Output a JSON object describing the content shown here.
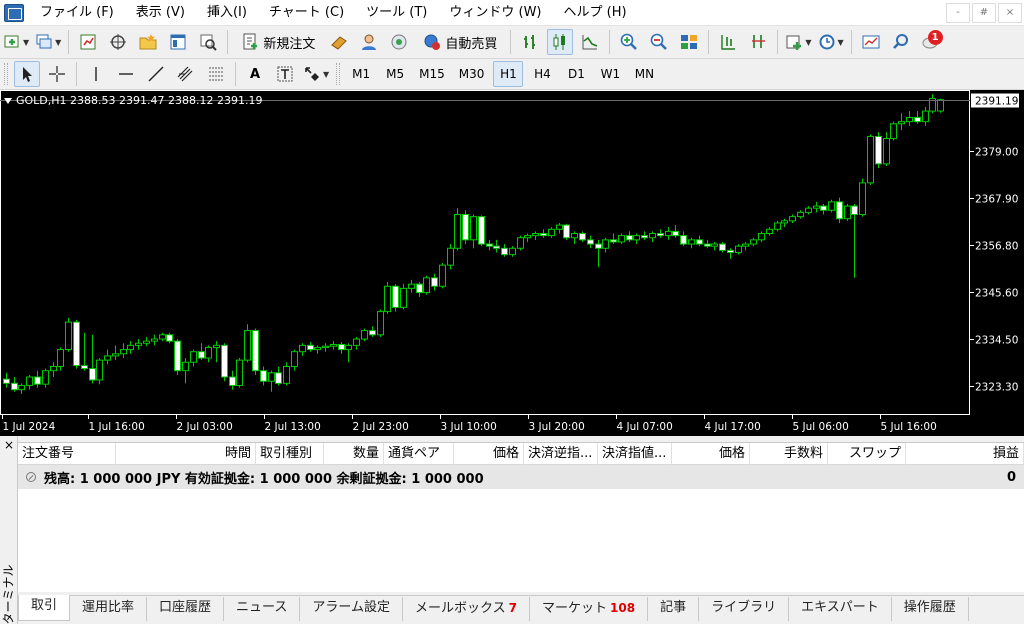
{
  "menu": {
    "items": [
      "ファイル (F)",
      "表示 (V)",
      "挿入(I)",
      "チャート (C)",
      "ツール (T)",
      "ウィンドウ (W)",
      "ヘルプ (H)"
    ],
    "win_controls": [
      "-",
      "#",
      "×"
    ]
  },
  "toolbar1": {
    "new_order_label": "新規注文",
    "auto_trading_label": "自動売買",
    "notification_count": "1"
  },
  "toolbar2": {
    "timeframes": [
      "M1",
      "M5",
      "M15",
      "M30",
      "H1",
      "H4",
      "D1",
      "W1",
      "MN"
    ],
    "active_timeframe": "H1",
    "text_tool": "A"
  },
  "chart": {
    "symbol_info": "GOLD,H1  2388.53 2391.47 2388.12 2391.19",
    "current_price": "2391.19",
    "colors": {
      "background": "#000000",
      "up_body": "#000000",
      "down_body": "#ffffff",
      "wick": "#00c800",
      "text": "#ffffff"
    }
  },
  "chart_data": {
    "type": "candlestick",
    "title": "GOLD,H1",
    "y_ticks": [
      2323.3,
      2334.5,
      2345.6,
      2356.8,
      2367.9,
      2379.0
    ],
    "ylim": [
      2316.5,
      2393.5
    ],
    "x_ticks": [
      "1 Jul 2024",
      "1 Jul 16:00",
      "2 Jul 03:00",
      "2 Jul 13:00",
      "2 Jul 23:00",
      "3 Jul 10:00",
      "3 Jul 20:00",
      "4 Jul 07:00",
      "4 Jul 17:00",
      "5 Jul 06:00",
      "5 Jul 16:00"
    ],
    "last": {
      "open": 2388.53,
      "high": 2391.47,
      "low": 2388.12,
      "close": 2391.19
    },
    "candles": [
      [
        2325.0,
        2326.5,
        2323.0,
        2324.0
      ],
      [
        2324.0,
        2325.5,
        2322.0,
        2322.5
      ],
      [
        2322.5,
        2324.0,
        2321.5,
        2323.5
      ],
      [
        2323.5,
        2326.0,
        2322.5,
        2325.5
      ],
      [
        2325.5,
        2327.0,
        2323.0,
        2323.8
      ],
      [
        2323.8,
        2327.5,
        2323.0,
        2327.0
      ],
      [
        2327.0,
        2329.0,
        2325.5,
        2328.0
      ],
      [
        2328.0,
        2332.5,
        2327.0,
        2332.0
      ],
      [
        2332.0,
        2339.5,
        2331.5,
        2338.5
      ],
      [
        2338.5,
        2339.0,
        2327.5,
        2328.2
      ],
      [
        2328.2,
        2336.0,
        2327.0,
        2327.5
      ],
      [
        2327.5,
        2335.5,
        2324.0,
        2324.8
      ],
      [
        2324.8,
        2330.0,
        2323.8,
        2329.5
      ],
      [
        2329.5,
        2332.0,
        2328.5,
        2330.5
      ],
      [
        2330.5,
        2333.0,
        2329.5,
        2331.0
      ],
      [
        2331.0,
        2333.5,
        2330.0,
        2332.0
      ],
      [
        2332.0,
        2334.0,
        2331.0,
        2333.0
      ],
      [
        2333.0,
        2334.5,
        2332.0,
        2333.5
      ],
      [
        2333.5,
        2335.0,
        2332.8,
        2334.0
      ],
      [
        2334.0,
        2335.5,
        2333.0,
        2334.5
      ],
      [
        2334.5,
        2336.0,
        2334.0,
        2335.5
      ],
      [
        2335.5,
        2336.0,
        2333.5,
        2334.0
      ],
      [
        2334.0,
        2334.5,
        2326.0,
        2327.0
      ],
      [
        2327.0,
        2330.0,
        2324.0,
        2329.0
      ],
      [
        2329.0,
        2332.0,
        2328.0,
        2331.5
      ],
      [
        2331.5,
        2333.5,
        2329.5,
        2330.0
      ],
      [
        2330.0,
        2333.0,
        2329.0,
        2332.5
      ],
      [
        2332.5,
        2334.0,
        2329.0,
        2333.0
      ],
      [
        2333.0,
        2333.5,
        2324.5,
        2325.5
      ],
      [
        2325.5,
        2327.0,
        2322.5,
        2323.5
      ],
      [
        2323.5,
        2330.0,
        2323.0,
        2329.5
      ],
      [
        2329.5,
        2338.0,
        2329.0,
        2336.5
      ],
      [
        2336.5,
        2337.0,
        2326.0,
        2327.0
      ],
      [
        2327.0,
        2328.0,
        2323.5,
        2324.5
      ],
      [
        2324.5,
        2327.0,
        2322.0,
        2326.5
      ],
      [
        2326.5,
        2328.0,
        2323.5,
        2324.0
      ],
      [
        2324.0,
        2329.0,
        2323.5,
        2328.0
      ],
      [
        2328.0,
        2332.0,
        2327.0,
        2331.5
      ],
      [
        2331.5,
        2333.5,
        2330.5,
        2333.0
      ],
      [
        2333.0,
        2333.8,
        2331.5,
        2332.0
      ],
      [
        2332.0,
        2333.0,
        2331.0,
        2332.5
      ],
      [
        2332.5,
        2333.5,
        2331.5,
        2332.8
      ],
      [
        2332.8,
        2334.0,
        2332.0,
        2333.2
      ],
      [
        2333.2,
        2333.8,
        2331.0,
        2332.0
      ],
      [
        2332.0,
        2333.5,
        2329.0,
        2333.0
      ],
      [
        2333.0,
        2335.0,
        2332.0,
        2334.5
      ],
      [
        2334.5,
        2337.0,
        2334.0,
        2336.5
      ],
      [
        2336.5,
        2337.5,
        2335.0,
        2335.5
      ],
      [
        2335.5,
        2341.5,
        2335.0,
        2341.0
      ],
      [
        2341.0,
        2348.0,
        2340.5,
        2347.0
      ],
      [
        2347.0,
        2347.5,
        2341.0,
        2342.0
      ],
      [
        2342.0,
        2347.5,
        2341.5,
        2346.5
      ],
      [
        2346.5,
        2348.5,
        2345.5,
        2347.5
      ],
      [
        2347.5,
        2348.0,
        2344.5,
        2345.5
      ],
      [
        2345.5,
        2349.5,
        2345.0,
        2349.0
      ],
      [
        2349.0,
        2350.0,
        2346.0,
        2347.0
      ],
      [
        2347.0,
        2352.5,
        2346.5,
        2352.0
      ],
      [
        2352.0,
        2357.0,
        2351.0,
        2356.0
      ],
      [
        2356.0,
        2365.5,
        2355.5,
        2364.0
      ],
      [
        2364.0,
        2365.0,
        2357.0,
        2358.0
      ],
      [
        2358.0,
        2364.0,
        2356.0,
        2363.5
      ],
      [
        2363.5,
        2363.8,
        2356.5,
        2357.0
      ],
      [
        2357.0,
        2358.0,
        2355.5,
        2356.5
      ],
      [
        2356.5,
        2358.0,
        2355.0,
        2356.0
      ],
      [
        2356.0,
        2357.0,
        2354.0,
        2354.5
      ],
      [
        2354.5,
        2356.5,
        2354.0,
        2356.0
      ],
      [
        2356.0,
        2359.0,
        2355.5,
        2358.5
      ],
      [
        2358.5,
        2359.5,
        2357.5,
        2359.0
      ],
      [
        2359.0,
        2360.0,
        2358.0,
        2359.5
      ],
      [
        2359.5,
        2360.5,
        2358.5,
        2359.0
      ],
      [
        2359.0,
        2361.0,
        2358.5,
        2360.5
      ],
      [
        2360.5,
        2362.0,
        2359.5,
        2361.5
      ],
      [
        2361.5,
        2361.8,
        2358.0,
        2358.5
      ],
      [
        2358.5,
        2360.0,
        2357.0,
        2359.5
      ],
      [
        2359.5,
        2360.0,
        2357.5,
        2358.0
      ],
      [
        2358.0,
        2359.0,
        2356.0,
        2357.0
      ],
      [
        2357.0,
        2358.0,
        2351.5,
        2356.0
      ],
      [
        2356.0,
        2358.5,
        2355.0,
        2358.0
      ],
      [
        2358.0,
        2359.5,
        2357.0,
        2357.5
      ],
      [
        2357.5,
        2359.5,
        2357.0,
        2359.0
      ],
      [
        2359.0,
        2360.0,
        2357.5,
        2358.0
      ],
      [
        2358.0,
        2359.5,
        2357.0,
        2359.0
      ],
      [
        2359.0,
        2360.0,
        2358.0,
        2358.5
      ],
      [
        2358.5,
        2360.0,
        2357.5,
        2359.5
      ],
      [
        2359.5,
        2360.5,
        2358.5,
        2359.0
      ],
      [
        2359.0,
        2361.0,
        2358.0,
        2360.0
      ],
      [
        2360.0,
        2361.5,
        2358.5,
        2359.0
      ],
      [
        2359.0,
        2360.0,
        2356.5,
        2357.0
      ],
      [
        2357.0,
        2358.5,
        2356.0,
        2358.0
      ],
      [
        2358.0,
        2359.0,
        2356.5,
        2357.0
      ],
      [
        2357.0,
        2358.0,
        2356.0,
        2356.5
      ],
      [
        2356.5,
        2357.5,
        2355.5,
        2357.0
      ],
      [
        2357.0,
        2357.5,
        2355.0,
        2355.5
      ],
      [
        2355.5,
        2356.0,
        2353.5,
        2355.0
      ],
      [
        2355.0,
        2357.0,
        2354.5,
        2356.5
      ],
      [
        2356.5,
        2357.5,
        2355.5,
        2357.0
      ],
      [
        2357.0,
        2358.5,
        2356.5,
        2358.0
      ],
      [
        2358.0,
        2360.0,
        2357.5,
        2359.5
      ],
      [
        2359.5,
        2361.0,
        2359.0,
        2360.5
      ],
      [
        2360.5,
        2362.5,
        2360.0,
        2362.0
      ],
      [
        2362.0,
        2363.0,
        2361.0,
        2362.5
      ],
      [
        2362.5,
        2364.0,
        2362.0,
        2363.5
      ],
      [
        2363.5,
        2365.0,
        2363.0,
        2364.5
      ],
      [
        2364.5,
        2366.0,
        2364.0,
        2365.5
      ],
      [
        2365.5,
        2367.0,
        2364.5,
        2366.0
      ],
      [
        2366.0,
        2366.5,
        2364.0,
        2365.0
      ],
      [
        2365.0,
        2367.5,
        2364.5,
        2367.0
      ],
      [
        2367.0,
        2368.0,
        2362.0,
        2363.0
      ],
      [
        2363.0,
        2366.5,
        2362.5,
        2366.0
      ],
      [
        2366.0,
        2366.5,
        2349.0,
        2364.0
      ],
      [
        2364.0,
        2372.5,
        2363.5,
        2371.5
      ],
      [
        2371.5,
        2383.0,
        2371.0,
        2382.5
      ],
      [
        2382.5,
        2383.5,
        2375.0,
        2376.0
      ],
      [
        2376.0,
        2383.5,
        2375.5,
        2382.0
      ],
      [
        2382.0,
        2386.0,
        2381.5,
        2385.5
      ],
      [
        2385.5,
        2388.0,
        2384.0,
        2386.0
      ],
      [
        2386.0,
        2388.5,
        2385.0,
        2387.0
      ],
      [
        2387.0,
        2388.5,
        2385.5,
        2386.0
      ],
      [
        2386.0,
        2389.5,
        2385.0,
        2388.5
      ],
      [
        2388.5,
        2392.5,
        2388.0,
        2391.5
      ],
      [
        2388.53,
        2391.47,
        2388.12,
        2391.19
      ]
    ]
  },
  "terminal": {
    "side_label": "ターミナル",
    "close": "×",
    "columns": [
      {
        "label": "注文番号",
        "align": "left"
      },
      {
        "label": "時間",
        "align": "right"
      },
      {
        "label": "取引種別",
        "align": "left"
      },
      {
        "label": "数量",
        "align": "right"
      },
      {
        "label": "通貨ペア",
        "align": "left"
      },
      {
        "label": "価格",
        "align": "right"
      },
      {
        "label": "決済逆指...",
        "align": "left"
      },
      {
        "label": "決済指値...",
        "align": "left"
      },
      {
        "label": "価格",
        "align": "right"
      },
      {
        "label": "手数料",
        "align": "right"
      },
      {
        "label": "スワップ",
        "align": "right"
      },
      {
        "label": "損益",
        "align": "right"
      }
    ],
    "balance_text": "残高: 1 000 000 JPY  有効証拠金: 1 000 000  余剰証拠金: 1 000 000",
    "balance_profit": "0",
    "tabs": [
      {
        "label": "取引",
        "badge": ""
      },
      {
        "label": "運用比率",
        "badge": ""
      },
      {
        "label": "口座履歴",
        "badge": ""
      },
      {
        "label": "ニュース",
        "badge": ""
      },
      {
        "label": "アラーム設定",
        "badge": ""
      },
      {
        "label": "メールボックス",
        "badge": "7"
      },
      {
        "label": "マーケット",
        "badge": "108"
      },
      {
        "label": "記事",
        "badge": ""
      },
      {
        "label": "ライブラリ",
        "badge": ""
      },
      {
        "label": "エキスパート",
        "badge": ""
      },
      {
        "label": "操作履歴",
        "badge": ""
      }
    ],
    "active_tab": "取引"
  }
}
